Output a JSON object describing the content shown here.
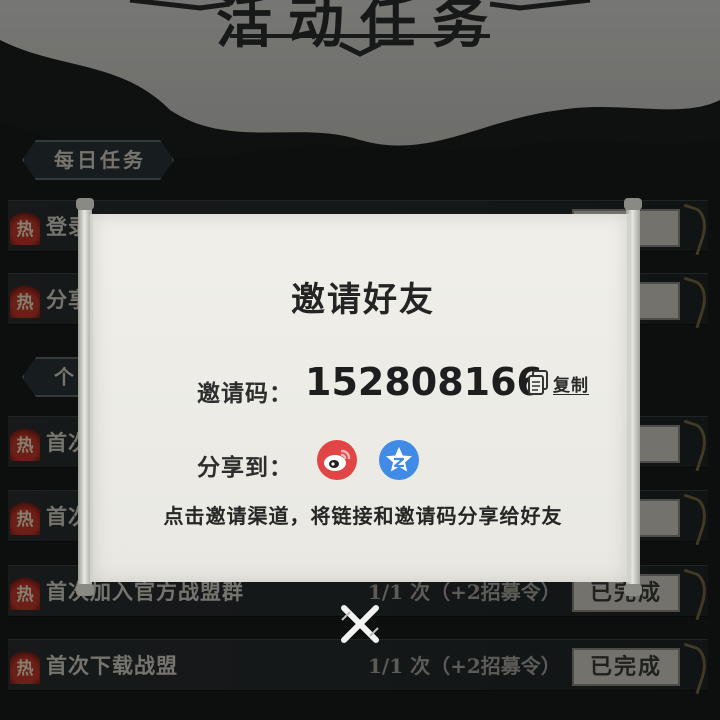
{
  "page": {
    "title": "活动任务"
  },
  "sections": {
    "daily": "每日任务",
    "personal": "个"
  },
  "tasks": [
    {
      "hot": "热",
      "name": "登录",
      "progress": "",
      "status": "成"
    },
    {
      "hot": "热",
      "name": "分享",
      "progress": "",
      "status": "成"
    },
    {
      "hot": "热",
      "name": "首次",
      "progress": "",
      "status": "成"
    },
    {
      "hot": "热",
      "name": "首次",
      "progress": "",
      "status": "成"
    },
    {
      "hot": "热",
      "name": "首次加入官方战盟群",
      "progress": "1/1 次（+2招募令）",
      "status": "已完成"
    },
    {
      "hot": "热",
      "name": "首次下载战盟",
      "progress": "1/1 次（+2招募令）",
      "status": "已完成"
    }
  ],
  "dialog": {
    "title": "邀请好友",
    "code_label": "邀请码：",
    "code_value": "152808166",
    "copy_label": "复制",
    "share_label": "分享到：",
    "share_channels": [
      {
        "name": "weibo",
        "icon": "weibo-icon",
        "color": "#e24545"
      },
      {
        "name": "qzone",
        "icon": "qzone-star-icon",
        "color": "#3f8be6"
      }
    ],
    "hint": "点击邀请渠道，将链接和邀请码分享给好友"
  },
  "colors": {
    "paper": "#efeee8",
    "dark_bg": "#1c1f1f",
    "hot_red": "#c53a2a"
  }
}
